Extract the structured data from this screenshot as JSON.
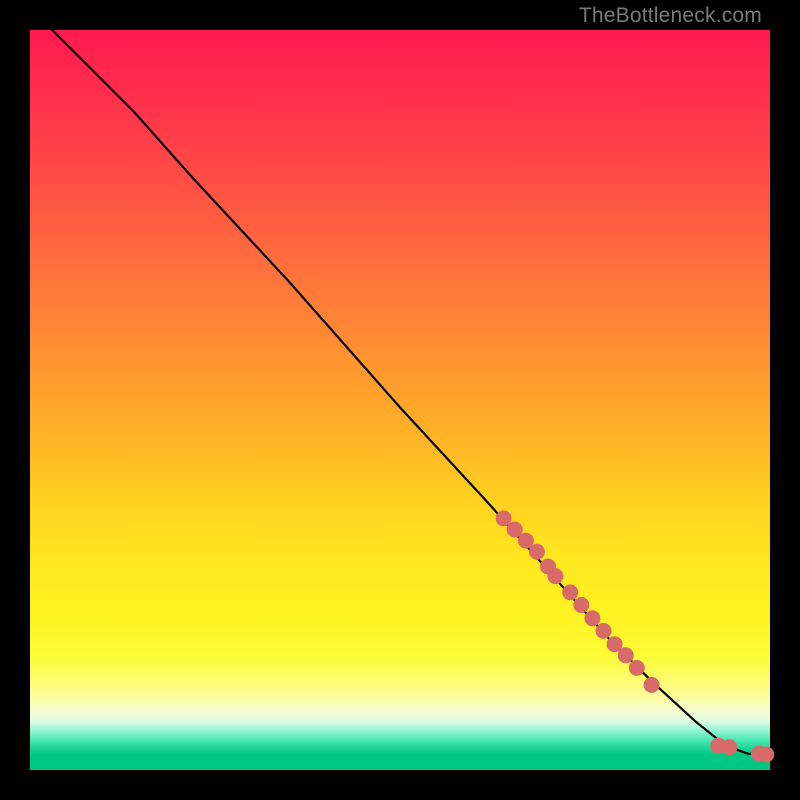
{
  "attribution": "TheBottleneck.com",
  "chart_data": {
    "type": "line",
    "title": "",
    "xlabel": "",
    "ylabel": "",
    "xlim": [
      0,
      100
    ],
    "ylim": [
      0,
      100
    ],
    "curve": {
      "x": [
        3,
        6,
        10,
        14,
        22,
        35,
        50,
        62,
        70,
        78,
        84,
        90,
        94,
        97,
        99.5
      ],
      "y": [
        100,
        97,
        93,
        89,
        80,
        66,
        49,
        36,
        27,
        18,
        12,
        6.5,
        3.3,
        2.2,
        2.1
      ]
    },
    "markers_y_equals_100_minus_x_region": {
      "note": "salmon circular markers along the descending line, clustered in the lower-right",
      "x": [
        64,
        65.5,
        67,
        68.5,
        70,
        71,
        73,
        74.5,
        76,
        77.5,
        79,
        80.5,
        82,
        84,
        93,
        94.5,
        98.5,
        99.5
      ],
      "y": [
        34,
        32.5,
        31,
        29.5,
        27.5,
        26.2,
        24,
        22.3,
        20.5,
        18.8,
        17,
        15.5,
        13.8,
        11.5,
        3.3,
        3.1,
        2.2,
        2.1
      ]
    },
    "gradient_stops": [
      {
        "pos": 0.0,
        "color": "#ff1a4d"
      },
      {
        "pos": 0.3,
        "color": "#ff6a3e"
      },
      {
        "pos": 0.64,
        "color": "#ffd21f"
      },
      {
        "pos": 0.85,
        "color": "#fcfc3a"
      },
      {
        "pos": 0.93,
        "color": "#d9fbe0"
      },
      {
        "pos": 0.97,
        "color": "#18d291"
      },
      {
        "pos": 1.0,
        "color": "#00c783"
      }
    ]
  }
}
